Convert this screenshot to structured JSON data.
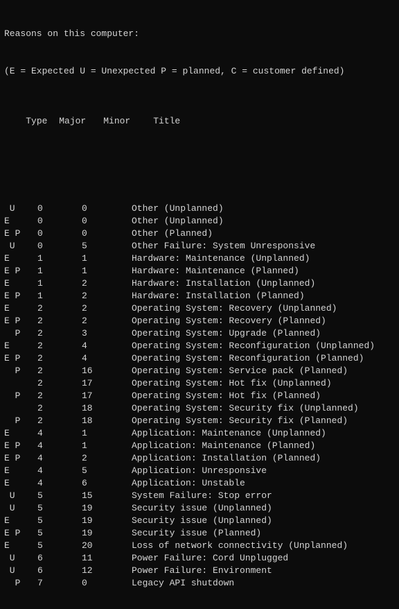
{
  "header": {
    "line1": "Reasons on this computer:",
    "legend": "(E = Expected U = Unexpected P = planned, C = customer defined)"
  },
  "columns": {
    "type": "Type",
    "major": "Major",
    "minor": "Minor",
    "title": "Title"
  },
  "rows": [
    {
      "type": " U",
      "major": "0",
      "minor": "0",
      "title": "Other (Unplanned)"
    },
    {
      "type": "E",
      "major": "0",
      "minor": "0",
      "title": "Other (Unplanned)"
    },
    {
      "type": "E P",
      "major": "0",
      "minor": "0",
      "title": "Other (Planned)"
    },
    {
      "type": " U",
      "major": "0",
      "minor": "5",
      "title": "Other Failure: System Unresponsive"
    },
    {
      "type": "E",
      "major": "1",
      "minor": "1",
      "title": "Hardware: Maintenance (Unplanned)"
    },
    {
      "type": "E P",
      "major": "1",
      "minor": "1",
      "title": "Hardware: Maintenance (Planned)"
    },
    {
      "type": "E",
      "major": "1",
      "minor": "2",
      "title": "Hardware: Installation (Unplanned)"
    },
    {
      "type": "E P",
      "major": "1",
      "minor": "2",
      "title": "Hardware: Installation (Planned)"
    },
    {
      "type": "E",
      "major": "2",
      "minor": "2",
      "title": "Operating System: Recovery (Unplanned)"
    },
    {
      "type": "E P",
      "major": "2",
      "minor": "2",
      "title": "Operating System: Recovery (Planned)"
    },
    {
      "type": "  P",
      "major": "2",
      "minor": "3",
      "title": "Operating System: Upgrade (Planned)"
    },
    {
      "type": "E",
      "major": "2",
      "minor": "4",
      "title": "Operating System: Reconfiguration (Unplanned)"
    },
    {
      "type": "E P",
      "major": "2",
      "minor": "4",
      "title": "Operating System: Reconfiguration (Planned)"
    },
    {
      "type": "  P",
      "major": "2",
      "minor": "16",
      "title": "Operating System: Service pack (Planned)"
    },
    {
      "type": "",
      "major": "2",
      "minor": "17",
      "title": "Operating System: Hot fix (Unplanned)"
    },
    {
      "type": "  P",
      "major": "2",
      "minor": "17",
      "title": "Operating System: Hot fix (Planned)"
    },
    {
      "type": "",
      "major": "2",
      "minor": "18",
      "title": "Operating System: Security fix (Unplanned)"
    },
    {
      "type": "  P",
      "major": "2",
      "minor": "18",
      "title": "Operating System: Security fix (Planned)"
    },
    {
      "type": "E",
      "major": "4",
      "minor": "1",
      "title": "Application: Maintenance (Unplanned)"
    },
    {
      "type": "E P",
      "major": "4",
      "minor": "1",
      "title": "Application: Maintenance (Planned)"
    },
    {
      "type": "E P",
      "major": "4",
      "minor": "2",
      "title": "Application: Installation (Planned)"
    },
    {
      "type": "E",
      "major": "4",
      "minor": "5",
      "title": "Application: Unresponsive"
    },
    {
      "type": "E",
      "major": "4",
      "minor": "6",
      "title": "Application: Unstable"
    },
    {
      "type": " U",
      "major": "5",
      "minor": "15",
      "title": "System Failure: Stop error"
    },
    {
      "type": " U",
      "major": "5",
      "minor": "19",
      "title": "Security issue (Unplanned)"
    },
    {
      "type": "E",
      "major": "5",
      "minor": "19",
      "title": "Security issue (Unplanned)"
    },
    {
      "type": "E P",
      "major": "5",
      "minor": "19",
      "title": "Security issue (Planned)"
    },
    {
      "type": "E",
      "major": "5",
      "minor": "20",
      "title": "Loss of network connectivity (Unplanned)"
    },
    {
      "type": " U",
      "major": "6",
      "minor": "11",
      "title": "Power Failure: Cord Unplugged"
    },
    {
      "type": " U",
      "major": "6",
      "minor": "12",
      "title": "Power Failure: Environment"
    },
    {
      "type": "  P",
      "major": "7",
      "minor": "0",
      "title": "Legacy API shutdown"
    }
  ]
}
